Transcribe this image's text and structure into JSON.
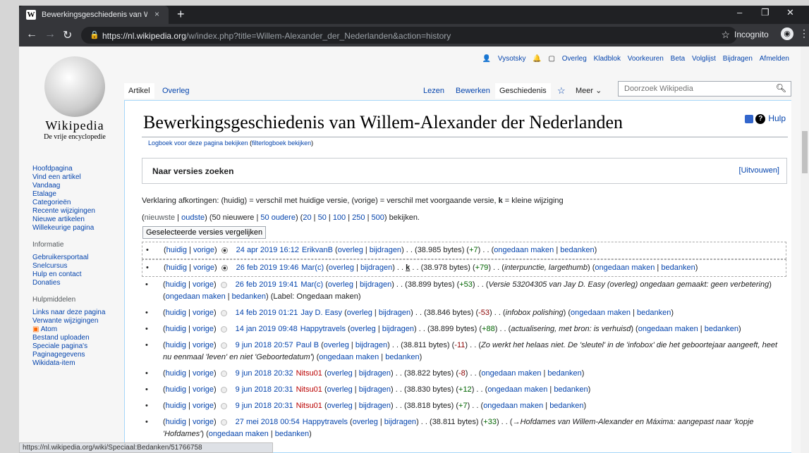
{
  "browser": {
    "tab_title": "Bewerkingsgeschiedenis van Will",
    "tab_close": "×",
    "new_tab": "+",
    "window_controls": [
      "–",
      "❐",
      "✕"
    ],
    "url_scheme": "https://",
    "url_host": "nl.wikipedia.org",
    "url_path": "/w/index.php?title=Willem-Alexander_der_Nederlanden&action=history",
    "incognito_label": "Incognito",
    "status_bar": "https://nl.wikipedia.org/wiki/Speciaal:Bedanken/51766758"
  },
  "personal": {
    "user": "Vysotsky",
    "links": [
      "Overleg",
      "Kladblok",
      "Voorkeuren",
      "Beta",
      "Volglijst",
      "Bijdragen",
      "Afmelden"
    ]
  },
  "logo": {
    "wordmark": "Wikipedia",
    "tagline": "De vrije encyclopedie"
  },
  "sidebar": {
    "main": [
      "Hoofdpagina",
      "Vind een artikel",
      "Vandaag",
      "Etalage",
      "Categorieën",
      "Recente wijzigingen",
      "Nieuwe artikelen",
      "Willekeurige pagina"
    ],
    "info_heading": "Informatie",
    "info": [
      "Gebruikersportaal",
      "Snelcursus",
      "Hulp en contact",
      "Donaties"
    ],
    "tools_heading": "Hulpmiddelen",
    "tools": [
      "Links naar deze pagina",
      "Verwante wijzigingen",
      "Atom",
      "Bestand uploaden",
      "Speciale pagina's",
      "Paginagegevens",
      "Wikidata-item"
    ]
  },
  "tabs": {
    "article": "Artikel",
    "talk": "Overleg",
    "read": "Lezen",
    "edit": "Bewerken",
    "history": "Geschiedenis",
    "more": "Meer",
    "search_placeholder": "Doorzoek Wikipedia"
  },
  "content": {
    "title": "Bewerkingsgeschiedenis van Willem-Alexander der Nederlanden",
    "help": "Hulp",
    "log_link": "Logboek voor deze pagina bekijken",
    "filter_log_link": "filterlogboek bekijken",
    "filter_title": "Naar versies zoeken",
    "expand": "[Uitvouwen]",
    "legend_a": "Verklaring afkortingen: (huidig) = verschil met huidige versie, (vorige) = verschil met voorgaande versie, ",
    "legend_k": "k",
    "legend_b": " = kleine wijziging",
    "pager_newest": "nieuwste",
    "pager_oldest": "oudste",
    "pager_mid": ") (50 nieuwere | ",
    "pager_older": "50 oudere",
    "pager_sizes": [
      "20",
      "50",
      "100",
      "250",
      "500"
    ],
    "pager_tail": ") bekijken.",
    "compare_button": "Geselecteerde versies vergelijken"
  },
  "common": {
    "cur": "huidig",
    "prev": "vorige",
    "talk": "overleg",
    "contribs": "bijdragen",
    "undo": "ongedaan maken",
    "thank": "bedanken"
  },
  "revisions": [
    {
      "date": "24 apr 2019 16:12",
      "user": "ErikvanB",
      "size": "38.985 bytes",
      "diff": "+7",
      "minor": false,
      "comment": "",
      "tag": ""
    },
    {
      "date": "26 feb 2019 19:46",
      "user": "Mar(c)",
      "size": "38.978 bytes",
      "diff": "+79",
      "minor": true,
      "comment": "interpunctie, largethumb",
      "tag": ""
    },
    {
      "date": "26 feb 2019 19:41",
      "user": "Mar(c)",
      "size": "38.899 bytes",
      "diff": "+53",
      "minor": false,
      "comment": "Versie 53204305 van Jay D. Easy (overleg) ongedaan gemaakt: geen verbetering",
      "tag": "Ongedaan maken"
    },
    {
      "date": "14 feb 2019 01:21",
      "user": "Jay D. Easy",
      "size": "38.846 bytes",
      "diff": "-53",
      "minor": false,
      "comment": "infobox polishing",
      "tag": ""
    },
    {
      "date": "14 jan 2019 09:48",
      "user": "Happytravels",
      "size": "38.899 bytes",
      "diff": "+88",
      "minor": false,
      "comment": "actualisering, met bron: is verhuisd",
      "tag": ""
    },
    {
      "date": "9 jun 2018 20:57",
      "user": "Paul B",
      "size": "38.811 bytes",
      "diff": "-11",
      "minor": false,
      "comment": "Zo werkt het helaas niet. De 'sleutel' in de 'infobox' die het geboortejaar aangeeft, heet nu eenmaal 'leven' en niet 'Geboortedatum'",
      "tag": ""
    },
    {
      "date": "9 jun 2018 20:32",
      "user": "Nitsu01",
      "size": "38.822 bytes",
      "diff": "-8",
      "minor": false,
      "comment": "",
      "tag": ""
    },
    {
      "date": "9 jun 2018 20:31",
      "user": "Nitsu01",
      "size": "38.830 bytes",
      "diff": "+12",
      "minor": false,
      "comment": "",
      "tag": ""
    },
    {
      "date": "9 jun 2018 20:31",
      "user": "Nitsu01",
      "size": "38.818 bytes",
      "diff": "+7",
      "minor": false,
      "comment": "",
      "tag": ""
    },
    {
      "date": "27 mei 2018 00:54",
      "user": "Happytravels",
      "size": "38.811 bytes",
      "diff": "+33",
      "minor": false,
      "comment": "→Hofdames van Willem-Alexander en Máxima: aangepast naar 'kopje 'Hofdames'",
      "tag": ""
    }
  ]
}
